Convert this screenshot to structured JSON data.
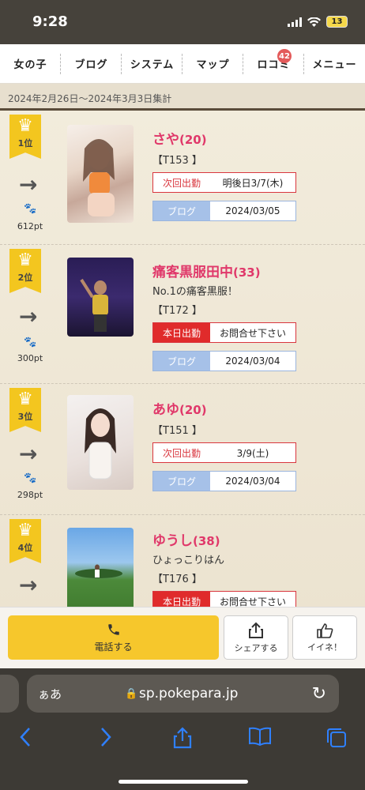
{
  "status": {
    "time": "9:28",
    "battery": "13"
  },
  "nav": {
    "items": [
      {
        "label": "女の子"
      },
      {
        "label": "ブログ"
      },
      {
        "label": "システム"
      },
      {
        "label": "マップ"
      },
      {
        "label": "ロコミ",
        "badge": "42"
      },
      {
        "label": "メニュー"
      }
    ]
  },
  "period": "2024年2月26日〜2024年3月3日集計",
  "ranking": [
    {
      "rank": "1位",
      "points": "612pt",
      "name": "さや",
      "age": "(20)",
      "comment": "",
      "tno": "【T153 】",
      "shift_label": "次回出勤",
      "shift_value": "明後日3/7(木)",
      "shift_today": false,
      "blog_label": "ブログ",
      "blog_date": "2024/03/05"
    },
    {
      "rank": "2位",
      "points": "300pt",
      "name": "痛客黒服田中",
      "age": "(33)",
      "comment": "No.1の痛客黒服！",
      "tno": "【T172 】",
      "shift_label": "本日出勤",
      "shift_value": "お問合せ下さい",
      "shift_today": true,
      "blog_label": "ブログ",
      "blog_date": "2024/03/04"
    },
    {
      "rank": "3位",
      "points": "298pt",
      "name": "あゆ",
      "age": "(20)",
      "comment": "",
      "tno": "【T151 】",
      "shift_label": "次回出勤",
      "shift_value": "3/9(土)",
      "shift_today": false,
      "blog_label": "ブログ",
      "blog_date": "2024/03/04"
    },
    {
      "rank": "4位",
      "points": "",
      "name": "ゆうし",
      "age": "(38)",
      "comment": "ひょっこりはん",
      "tno": "【T176 】",
      "shift_label": "本日出勤",
      "shift_value": "お問合せ下さい",
      "shift_today": true,
      "blog_label": "",
      "blog_date": ""
    }
  ],
  "actions": {
    "call": "電話する",
    "share": "シェアする",
    "like": "イイネ！"
  },
  "browser": {
    "aa": "ぁあ",
    "url": "sp.pokepara.jp"
  },
  "colors": {
    "accent_pink": "#e0386a",
    "badge_gold": "#f3c61f",
    "shift_red": "#d9363e",
    "blog_blue": "#a6c1e8"
  }
}
